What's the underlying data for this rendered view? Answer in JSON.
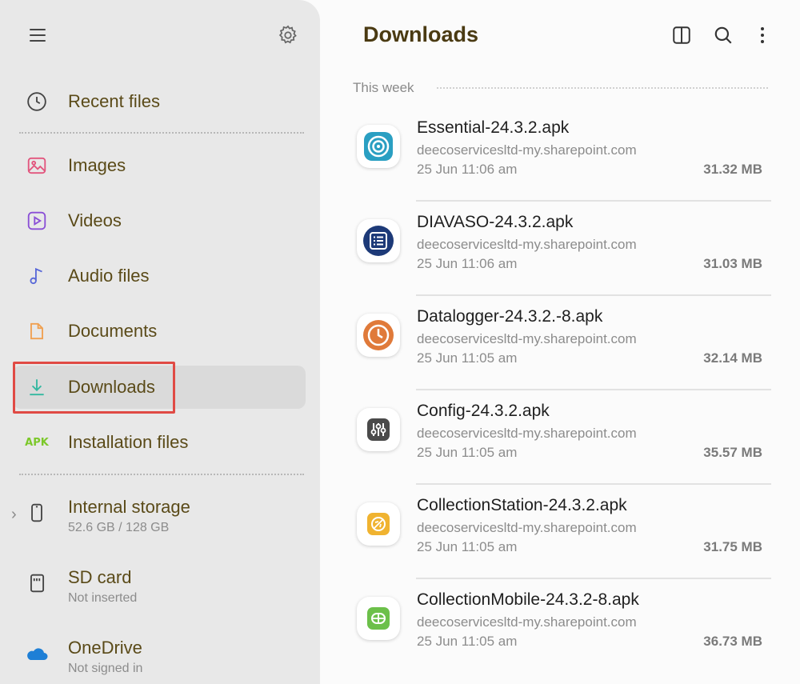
{
  "sidebar": {
    "items": [
      {
        "label": "Recent files",
        "icon": "clock-icon"
      },
      {
        "label": "Images",
        "icon": "image-icon",
        "color": "#e2557d"
      },
      {
        "label": "Videos",
        "icon": "video-icon",
        "color": "#8a4fd6"
      },
      {
        "label": "Audio files",
        "icon": "music-note-icon",
        "color": "#5868d8"
      },
      {
        "label": "Documents",
        "icon": "document-icon",
        "color": "#f0a050"
      },
      {
        "label": "Downloads",
        "icon": "download-icon",
        "color": "#32b8a0",
        "active": true
      },
      {
        "label": "Installation files",
        "icon": "apk-icon",
        "badge": "APK",
        "color": "#7cc82a"
      }
    ],
    "storage": [
      {
        "label": "Internal storage",
        "sub": "52.6 GB / 128 GB",
        "icon": "phone-icon"
      },
      {
        "label": "SD card",
        "sub": "Not inserted",
        "icon": "sd-card-icon"
      },
      {
        "label": "OneDrive",
        "sub": "Not signed in",
        "icon": "onedrive-cloud-icon",
        "color": "#1e7fd6"
      }
    ]
  },
  "main": {
    "title": "Downloads",
    "section": "This week",
    "files": [
      {
        "name": "Essential-24.3.2.apk",
        "source": "deecoservicesltd-my.sharepoint.com",
        "date": "25 Jun 11:06 am",
        "size": "31.32 MB",
        "icon": "essential-app-icon",
        "color": "#2a9fc2"
      },
      {
        "name": "DIAVASO-24.3.2.apk",
        "source": "deecoservicesltd-my.sharepoint.com",
        "date": "25 Jun 11:06 am",
        "size": "31.03 MB",
        "icon": "diavaso-app-icon",
        "color": "#1d3a78"
      },
      {
        "name": "Datalogger-24.3.2.-8.apk",
        "source": "deecoservicesltd-my.sharepoint.com",
        "date": "25 Jun 11:05 am",
        "size": "32.14 MB",
        "icon": "datalogger-app-icon",
        "color": "#e07a3a"
      },
      {
        "name": "Config-24.3.2.apk",
        "source": "deecoservicesltd-my.sharepoint.com",
        "date": "25 Jun 11:05 am",
        "size": "35.57 MB",
        "icon": "config-app-icon",
        "color": "#4a4a4a"
      },
      {
        "name": "CollectionStation-24.3.2.apk",
        "source": "deecoservicesltd-my.sharepoint.com",
        "date": "25 Jun 11:05 am",
        "size": "31.75 MB",
        "icon": "collection-station-app-icon",
        "color": "#f0b330"
      },
      {
        "name": "CollectionMobile-24.3.2-8.apk",
        "source": "deecoservicesltd-my.sharepoint.com",
        "date": "25 Jun 11:05 am",
        "size": "36.73 MB",
        "icon": "collection-mobile-app-icon",
        "color": "#6cc04a"
      }
    ]
  }
}
